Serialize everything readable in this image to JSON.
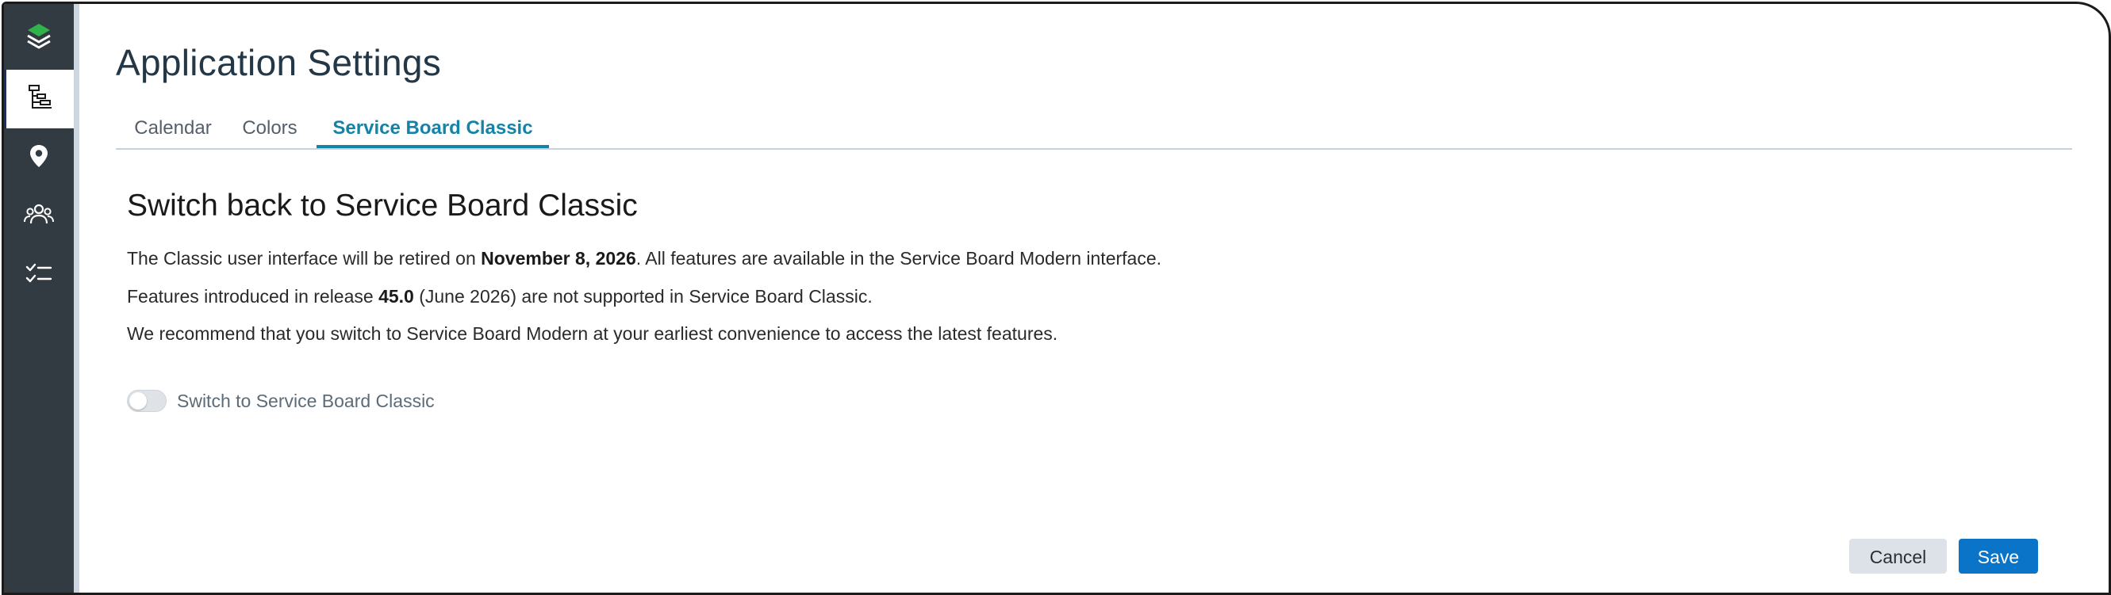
{
  "page": {
    "title": "Application Settings"
  },
  "sidebar": {
    "items": [
      {
        "name": "app-logo-icon",
        "active": false
      },
      {
        "name": "service-board-icon",
        "active": true
      },
      {
        "name": "location-pin-icon",
        "active": false
      },
      {
        "name": "people-icon",
        "active": false
      },
      {
        "name": "checklist-icon",
        "active": false
      }
    ]
  },
  "tabs": [
    {
      "label": "Calendar",
      "active": false
    },
    {
      "label": "Colors",
      "active": false
    },
    {
      "label": "Service Board Classic",
      "active": true
    }
  ],
  "content": {
    "heading": "Switch back to Service Board Classic",
    "line1": {
      "before": "The Classic user interface will be retired on ",
      "bold": "November 8, 2026",
      "after": ". All features are available in the Service Board Modern interface."
    },
    "line2": {
      "before": "Features introduced in release ",
      "bold": "45.0",
      "after": " (June 2026) are not supported in Service Board Classic."
    },
    "line3": "We recommend that you switch to Service Board Modern at your earliest convenience to access the latest features.",
    "toggle": {
      "label": "Switch to Service Board Classic",
      "checked": false
    }
  },
  "footer": {
    "cancel_label": "Cancel",
    "save_label": "Save"
  },
  "colors": {
    "sidebar": "#323a42",
    "accent": "#1583a8",
    "primary_button": "#0a74c9",
    "logo_green": "#2fb34a"
  }
}
